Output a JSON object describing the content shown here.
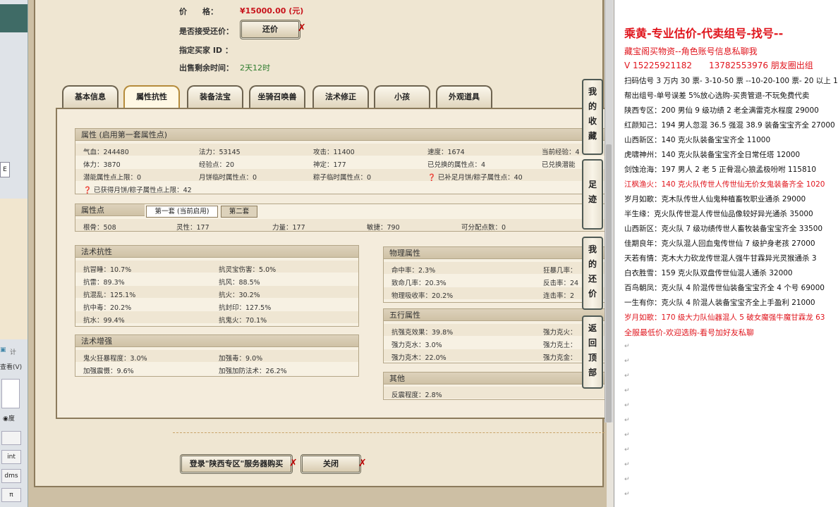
{
  "left_strip": {
    "tabs": [
      "E"
    ],
    "buttons": [
      "int",
      "dms",
      "π"
    ],
    "radio_label": "度",
    "text_a": "计",
    "text_b": "查看(V)"
  },
  "header": {
    "price_label": "价　　格：",
    "price_value": "¥15000.00 (元)",
    "counter_offer_label": "是否接受还价：",
    "counter_offer_button": "还价",
    "buyer_id_label": "指定买家 ID ：",
    "time_left_label": "出售剩余时间：",
    "time_left_value": "2天12时"
  },
  "tabs": [
    "基本信息",
    "属性抗性",
    "装备法宝",
    "坐骑召唤兽",
    "法术修正",
    "小孩",
    "外观道具"
  ],
  "attr": {
    "title": "属性 (启用第一套属性点)",
    "rows": [
      [
        "气血：244480",
        "法力：53145",
        "攻击：11400",
        "速度：1674",
        "当前经验：4"
      ],
      [
        "体力：3870",
        "经验点：20",
        "神定：177",
        "已兑换的属性点：4",
        "已兑换潜能"
      ],
      [
        "潜能属性点上限：0",
        "月饼临时属性点：0",
        "粽子临时属性点：0",
        "已补足月饼/粽子属性点：40",
        ""
      ]
    ],
    "note": "已获得月饼/粽子属性点上限：42"
  },
  "points": {
    "title": "属性点",
    "tab1": "第一套 (当前启用)",
    "tab2": "第二套",
    "values": [
      "根骨：508",
      "灵性：177",
      "力量：177",
      "敏捷：790",
      "可分配点数：0"
    ]
  },
  "resist": {
    "title": "法术抗性",
    "left": [
      "抗冒睡：10.7%",
      "抗雷：89.3%",
      "抗混乱：125.1%",
      "抗中毒：20.2%",
      "抗水：99.4%"
    ],
    "right": [
      "抗灵宝伤害：5.0%",
      "抗风：88.5%",
      "抗火：30.2%",
      "抗封印：127.5%",
      "抗鬼火：70.1%"
    ]
  },
  "enhance": {
    "title": "法术增强",
    "left": [
      "鬼火狂暴程度：3.0%",
      "加强震慑：9.6%"
    ],
    "right": [
      "加强毒：9.0%",
      "加强加防法术：26.2%"
    ]
  },
  "physical": {
    "title": "物理属性",
    "left": [
      "命中率：2.3%",
      "致命几率：20.3%",
      "物理吸收率：20.2%"
    ],
    "right": [
      "狂暴几率：",
      "反击率：24",
      "连击率：2"
    ]
  },
  "elements": {
    "title": "五行属性",
    "left": [
      "抗强克效果：39.8%",
      "强力克水：3.0%",
      "强力克木：22.0%"
    ],
    "right": [
      "强力克火：",
      "强力克土：",
      "强力克金："
    ]
  },
  "other": {
    "title": "其他",
    "left": [
      "反震程度：2.8%"
    ]
  },
  "side_tabs": [
    "我的收藏",
    "足迹",
    "我的还价",
    "返回顶部"
  ],
  "buttons": {
    "buy": "登录\"陕西专区\"服务器购买",
    "close": "关闭"
  },
  "notes": {
    "title": "乘黄-专业估价-代卖组号-找号--",
    "lines": [
      {
        "text": "藏宝阁买物资--角色账号信息私聊我",
        "red": true
      },
      {
        "text": "V 15225921182　　13782553976 朋友圈出组",
        "red": true
      },
      {
        "text": "扫码估号 3 万内 30 票- 3-10-50 票 --10-20-100 票- 20 以上 1",
        "red": false
      },
      {
        "text": "帮出组号-单号误差 5%放心选购-买贵管退-不玩免费代卖",
        "red": false
      },
      {
        "text": "陕西专区：200 男仙 9 级功绩 2 老全满雷克水程度 29000",
        "red": false
      },
      {
        "text": "红颜知己：194 男人忽混 36.5 强混 38.9 装备宝宝齐全 27000",
        "red": false
      },
      {
        "text": "山西新区：140 克火队装备宝宝齐全 11000",
        "red": false
      },
      {
        "text": "虎啸神州：140 克火队装备宝宝齐全日常任塔 12000",
        "red": false
      },
      {
        "text": "剑蚀沧海：197 男人 2 老 5 正骨混心狼孟极吩咐 115810",
        "red": false
      },
      {
        "text": "江枫渔火：140 克火队传世人传世仙无价女鬼装备齐全 1020",
        "red": true
      },
      {
        "text": "岁月如歌：克木队传世人仙鬼种植畜牧职业通杀 29000",
        "red": false
      },
      {
        "text": "半生缘：克火队传世混人传世仙品像较好异光通杀 35000",
        "red": false
      },
      {
        "text": "山西新区：克火队 7 级功绩传世人畜牧装备宝宝齐全 33500",
        "red": false
      },
      {
        "text": "佳期良年：克火队混人回血鬼传世仙 7 级护身老孩 27000",
        "red": false
      },
      {
        "text": "天若有情：克木大力砍龙传世混人强牛甘霖异光灵猴通杀 3",
        "red": false
      },
      {
        "text": "白衣胜雪：159 克火队双盘传世仙混人通杀 32000",
        "red": false
      },
      {
        "text": "百鸟朝凤：克火队 4 阶混传世仙装备宝宝齐全 4 个号 69000",
        "red": false
      },
      {
        "text": "一生有你：克火队 4 阶混人装备宝宝齐全上手盈利 21000",
        "red": false
      },
      {
        "text": "岁月如歌：170 级大力队仙器混人 5 破女魔强牛魔甘霖龙 63",
        "red": true
      },
      {
        "text": "全服最低价-欢迎选购-看号加好友私聊",
        "red": true
      }
    ]
  }
}
